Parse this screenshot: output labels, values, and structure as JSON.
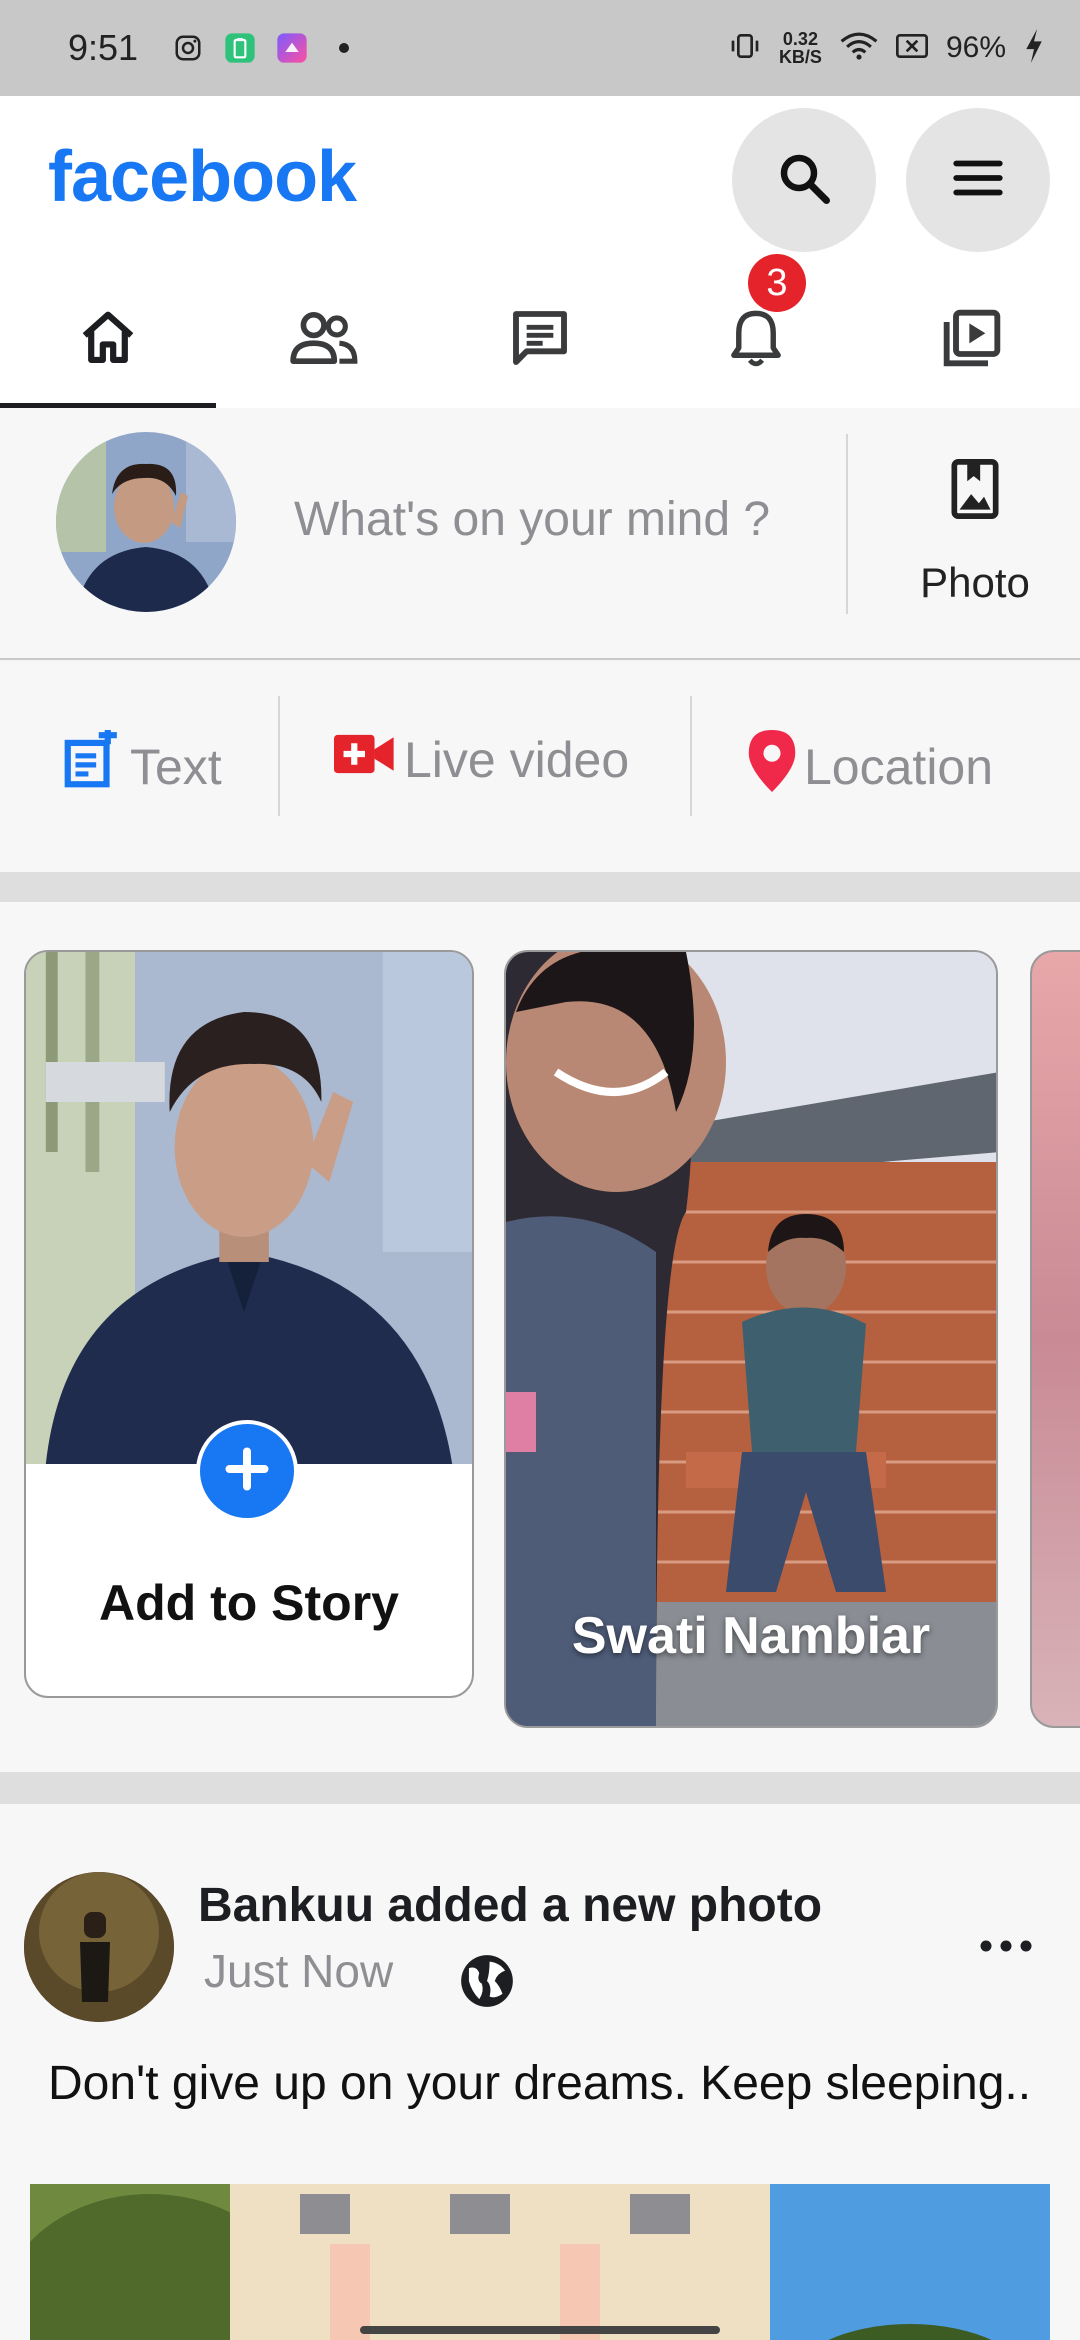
{
  "status_bar": {
    "time": "9:51",
    "speed_value": "0.32",
    "speed_unit": "KB/S",
    "battery": "96%"
  },
  "header": {
    "logo": "facebook",
    "search_icon": "search-icon",
    "menu_icon": "menu-icon"
  },
  "tabs": [
    {
      "icon": "home-icon",
      "active": true
    },
    {
      "icon": "friends-icon",
      "active": false
    },
    {
      "icon": "messages-icon",
      "active": false
    },
    {
      "icon": "bell-icon",
      "active": false,
      "badge": "3"
    },
    {
      "icon": "video-icon",
      "active": false
    }
  ],
  "composer": {
    "placeholder": "What's on your mind ?",
    "photo_label": "Photo"
  },
  "actions": {
    "text_label": "Text",
    "live_label": "Live video",
    "location_label": "Location"
  },
  "stories": {
    "add_label": "Add to Story",
    "story_name": "Swati Nambiar"
  },
  "post": {
    "title": "Bankuu added a new photo",
    "time": "Just Now",
    "text": "Don't give up on your dreams. Keep sleeping.."
  },
  "colors": {
    "brand": "#1877f2",
    "badge": "#e4242a",
    "live": "#e4242a",
    "location": "#f02849"
  }
}
